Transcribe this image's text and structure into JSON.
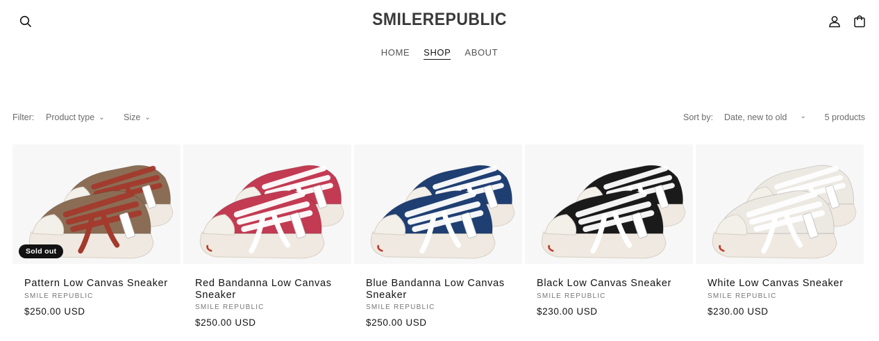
{
  "header": {
    "logo": "SMILEREPUBLIC",
    "nav": [
      {
        "label": "HOME",
        "active": false
      },
      {
        "label": "SHOP",
        "active": true
      },
      {
        "label": "ABOUT",
        "active": false
      }
    ],
    "icons": {
      "search": "search-icon",
      "account": "user-icon",
      "cart": "cart-icon"
    }
  },
  "toolbar": {
    "filter_label": "Filter:",
    "filter_product_type": "Product type",
    "filter_size": "Size",
    "sort_label": "Sort by:",
    "sort_value": "Date, new to old",
    "product_count": "5 products"
  },
  "products": [
    {
      "title": "Pattern Low Canvas Sneaker",
      "vendor": "SMILE REPUBLIC",
      "price": "$250.00 USD",
      "badge": "Sold out",
      "upper_color": "#8b6d55",
      "lace_color": "#a33a2c"
    },
    {
      "title": "Red Bandanna Low Canvas Sneaker",
      "vendor": "SMILE REPUBLIC",
      "price": "$250.00 USD",
      "badge": "",
      "upper_color": "#c23b52",
      "lace_color": "#ffffff"
    },
    {
      "title": "Blue Bandanna Low Canvas Sneaker",
      "vendor": "SMILE REPUBLIC",
      "price": "$250.00 USD",
      "badge": "",
      "upper_color": "#1f3f73",
      "lace_color": "#ffffff"
    },
    {
      "title": "Black Low Canvas Sneaker",
      "vendor": "SMILE REPUBLIC",
      "price": "$230.00 USD",
      "badge": "",
      "upper_color": "#1a1a1a",
      "lace_color": "#ffffff"
    },
    {
      "title": "White Low Canvas Sneaker",
      "vendor": "SMILE REPUBLIC",
      "price": "$230.00 USD",
      "badge": "",
      "upper_color": "#ece8e2",
      "lace_color": "#ffffff"
    }
  ]
}
